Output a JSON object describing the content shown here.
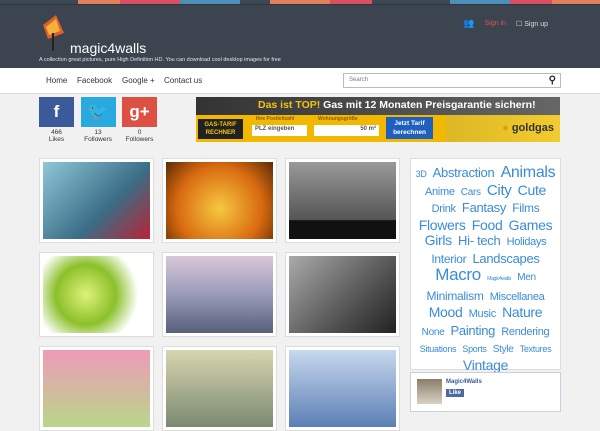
{
  "header": {
    "brand": "magic4walls",
    "tagline": "A collection great pictures, pure High Definition HD. You can download cool desktop images for free",
    "sign_in": "Sign in",
    "sign_up": "Sign up"
  },
  "nav": {
    "items": [
      "Home",
      "Facebook",
      "Google +",
      "Contact us"
    ],
    "search_placeholder": "Search"
  },
  "social": [
    {
      "icon": "f",
      "count": "466",
      "label": "Likes",
      "color": "#3b5a9a"
    },
    {
      "icon": "🐦",
      "count": "13",
      "label": "Followers",
      "color": "#2aa9e0"
    },
    {
      "icon": "g+",
      "count": "0",
      "label": "Followers",
      "color": "#dd5044"
    }
  ],
  "ad": {
    "headline_a": "Das ist TOP!",
    "headline_b": "Gas mit 12 Monaten Preisgarantie sichern!",
    "calc": "GAS-TARIF RECHNER",
    "plz_label": "Ihre Postleitzahl",
    "plz_placeholder": "PLZ eingeben",
    "size_label": "Wohnungsgröße",
    "size_value": "50 m²",
    "button": "Jetzt Tarif berechnen",
    "brand": "goldgas"
  },
  "tags": [
    {
      "t": "3D",
      "s": 9
    },
    {
      "t": "Abstraction",
      "s": 13
    },
    {
      "t": "Animals",
      "s": 16
    },
    {
      "t": "Anime",
      "s": 11
    },
    {
      "t": "Cars",
      "s": 10
    },
    {
      "t": "City",
      "s": 15
    },
    {
      "t": "Cute",
      "s": 14
    },
    {
      "t": "Drink",
      "s": 11
    },
    {
      "t": "Fantasy",
      "s": 13
    },
    {
      "t": "Films",
      "s": 12
    },
    {
      "t": "Flowers",
      "s": 14
    },
    {
      "t": "Food",
      "s": 14
    },
    {
      "t": "Games",
      "s": 14
    },
    {
      "t": "Girls",
      "s": 14
    },
    {
      "t": "Hi- tech",
      "s": 13
    },
    {
      "t": "Holidays",
      "s": 11
    },
    {
      "t": "Interior",
      "s": 12
    },
    {
      "t": "Landscapes",
      "s": 13
    },
    {
      "t": "Macro",
      "s": 17
    },
    {
      "t": "Magic4walls",
      "s": 5
    },
    {
      "t": "Men",
      "s": 10
    },
    {
      "t": "Minimalism",
      "s": 12
    },
    {
      "t": "Miscellanea",
      "s": 11
    },
    {
      "t": "Mood",
      "s": 14
    },
    {
      "t": "Music",
      "s": 11
    },
    {
      "t": "Nature",
      "s": 14
    },
    {
      "t": "None",
      "s": 10
    },
    {
      "t": "Painting",
      "s": 13
    },
    {
      "t": "Rendering",
      "s": 11
    },
    {
      "t": "Situations",
      "s": 9
    },
    {
      "t": "Sports",
      "s": 9
    },
    {
      "t": "Style",
      "s": 10
    },
    {
      "t": "Textures",
      "s": 9
    },
    {
      "t": "Vintage",
      "s": 14
    }
  ],
  "facebook": {
    "name": "Magic4Walls",
    "like": "Like"
  },
  "thumbs": [
    {
      "name": "vintage-car",
      "bg": "linear-gradient(135deg,#8fc7d8,#3a6d86 60%,#b23)"
    },
    {
      "name": "orange-drops",
      "bg": "radial-gradient(circle at 50% 60%,#f7c840,#d86a10 60%,#5a2a05)"
    },
    {
      "name": "minimal-figure",
      "bg": "linear-gradient(#9a9a9a,#555 75%,#111 76%)"
    },
    {
      "name": "lime-slices",
      "bg": "radial-gradient(circle at 40% 50%,#dff27a,#8cc02a 40%,#fff 70%)"
    },
    {
      "name": "pier-sunset",
      "bg": "linear-gradient(#d9c7d8,#9a9aba 50%,#56607a)"
    },
    {
      "name": "woman-rocks",
      "bg": "linear-gradient(135deg,#aaa,#555 60%,#222)"
    },
    {
      "name": "pink-flowers",
      "bg": "linear-gradient(#ee9ab8,#b8d78a)"
    },
    {
      "name": "fantasy-girl",
      "bg": "linear-gradient(#d8d4b0,#7a8a70)"
    },
    {
      "name": "water-drops",
      "bg": "linear-gradient(#c8d8ee,#5b7fb5)"
    }
  ]
}
